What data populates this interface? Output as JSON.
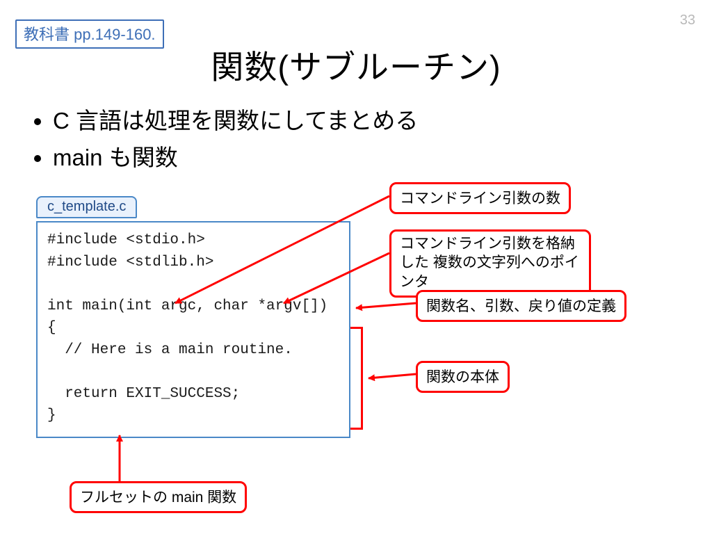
{
  "slide_number": "33",
  "textbook_ref": "教科書 pp.149-160.",
  "title": "関数(サブルーチン)",
  "bullets": {
    "b1": "C 言語は処理を関数にしてまとめる",
    "b2": "main も関数"
  },
  "file": {
    "tab_label": "c_template.c",
    "code": "#include <stdio.h>\n#include <stdlib.h>\n\nint main(int argc, char *argv[])\n{\n  // Here is a main routine.\n\n  return EXIT_SUCCESS;\n}"
  },
  "annotations": {
    "argc": "コマンドライン引数の数",
    "argv": "コマンドライン引数を格納した\n複数の文字列へのポインタ",
    "signature": "関数名、引数、戻り値の定義",
    "body": "関数の本体",
    "fullset": "フルセットの main 関数"
  },
  "colors": {
    "blue": "#3e6fb7",
    "red": "#ff0000"
  }
}
